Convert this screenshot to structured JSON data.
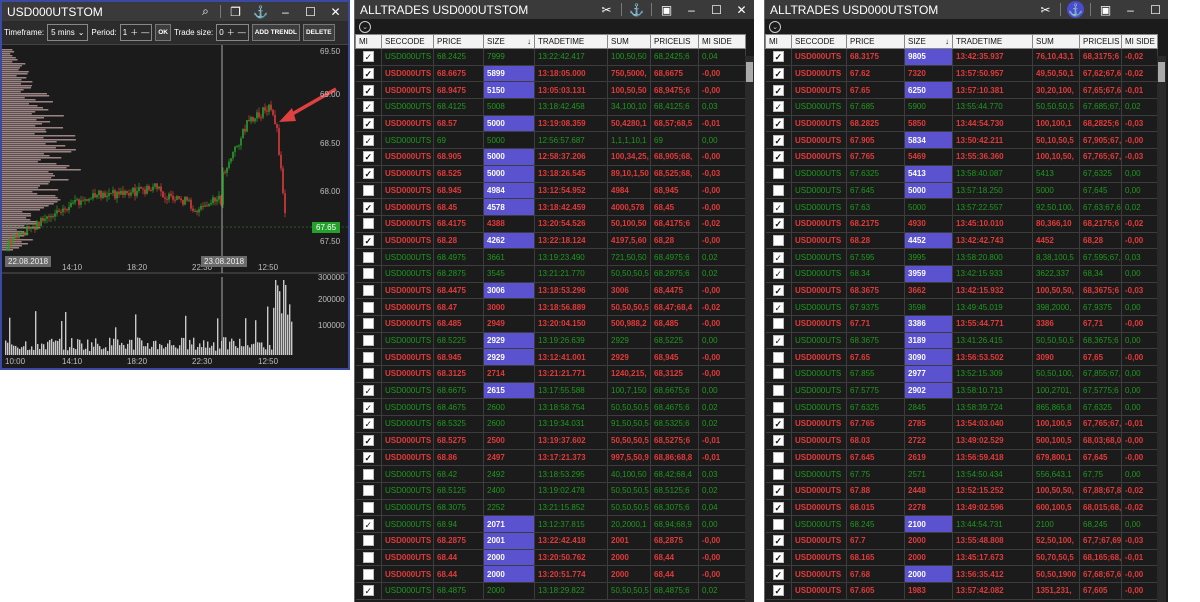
{
  "chart_window": {
    "title": "USD000UTSTOM",
    "toolbar": {
      "timeframe_label": "Timeframe:",
      "timeframe_value": "5 mins",
      "period_label": "Period:",
      "period_value": "1",
      "ok_label": "OK",
      "trade_size_label": "Trade size:",
      "trade_size_value": "0",
      "add_trendline_label": "ADD TRENDL",
      "delete_label": "DELETE"
    },
    "price_axis": [
      "69.50",
      "69.00",
      "68.50",
      "68.00",
      "67.50"
    ],
    "current_price": "67.65",
    "volume_axis": [
      "300000",
      "200000",
      "100000"
    ],
    "time_axis_top": [
      "14:10",
      "18:20",
      "22:30",
      "12:50"
    ],
    "time_axis_bottom": [
      "10:00",
      "14:10",
      "18:20",
      "22:30",
      "12:50"
    ],
    "date_tags": [
      "22.08.2018",
      "23.08.2018"
    ],
    "colors": {
      "up": "#27a127",
      "down": "#e03a3a",
      "profile": "#c8a8a8",
      "arrow": "#e04040"
    }
  },
  "trades_a": {
    "title": "ALLTRADES USD000UTSTOM",
    "columns": [
      "MI",
      "SECCODE",
      "PRICE",
      "SIZE",
      "TRADETIME",
      "SUM",
      "PRICELIS",
      "MI SIDE"
    ],
    "rows": [
      {
        "c": true,
        "s": "b",
        "sec": "USD000UTS",
        "price": "68.2425",
        "size": "7999",
        "time": "13:22:42.417",
        "sum": "100,50,50",
        "pl": "68,2425;6",
        "side": "0,04",
        "hl": false
      },
      {
        "c": true,
        "s": "s",
        "sec": "USD000UTS",
        "price": "68.6675",
        "size": "5899",
        "time": "13:18:05.000",
        "sum": "750,5000,",
        "pl": "68,6675",
        "side": "-0,00",
        "hl": true
      },
      {
        "c": true,
        "s": "s",
        "sec": "USD000UTS",
        "price": "68.9475",
        "size": "5150",
        "time": "13:05:03.131",
        "sum": "100,50,50",
        "pl": "68,9475;6",
        "side": "-0,00",
        "hl": true
      },
      {
        "c": true,
        "s": "b",
        "sec": "USD000UTS",
        "price": "68.4125",
        "size": "5008",
        "time": "13:18:42.458",
        "sum": "34,100,10",
        "pl": "68,4125;6",
        "side": "0,03",
        "hl": false
      },
      {
        "c": true,
        "s": "s",
        "sec": "USD000UTS",
        "price": "68.57",
        "size": "5000",
        "time": "13:19:08.359",
        "sum": "50,4280,1",
        "pl": "68,57;68,5",
        "side": "-0,01",
        "hl": true
      },
      {
        "c": true,
        "s": "b",
        "sec": "USD000UTS",
        "price": "69",
        "size": "5000",
        "time": "12:56:57.687",
        "sum": "1,1,1,10,1",
        "pl": "69",
        "side": "0,00",
        "hl": false
      },
      {
        "c": true,
        "s": "s",
        "sec": "USD000UTS",
        "price": "68.905",
        "size": "5000",
        "time": "12:58:37.206",
        "sum": "100,34,25,",
        "pl": "68,905;68,",
        "side": "-0,00",
        "hl": true
      },
      {
        "c": true,
        "s": "s",
        "sec": "USD000UTS",
        "price": "68.525",
        "size": "5000",
        "time": "13:18:26.545",
        "sum": "89,10,1,50",
        "pl": "68,525;68,",
        "side": "-0,03",
        "hl": true
      },
      {
        "c": false,
        "s": "s",
        "sec": "USD000UTS",
        "price": "68.945",
        "size": "4984",
        "time": "13:12:54.952",
        "sum": "4984",
        "pl": "68,945",
        "side": "-0,00",
        "hl": true
      },
      {
        "c": true,
        "s": "s",
        "sec": "USD000UTS",
        "price": "68.45",
        "size": "4578",
        "time": "13:18:42.459",
        "sum": "4000,578",
        "pl": "68,45",
        "side": "-0,00",
        "hl": true
      },
      {
        "c": false,
        "s": "s",
        "sec": "USD000UTS",
        "price": "68.4175",
        "size": "4388",
        "time": "13:20:54.526",
        "sum": "50,100,50",
        "pl": "68,4175;6",
        "side": "-0,02",
        "hl": false
      },
      {
        "c": true,
        "s": "s",
        "sec": "USD000UTS",
        "price": "68.28",
        "size": "4262",
        "time": "13:22:18.124",
        "sum": "4197,5,60",
        "pl": "68,28",
        "side": "-0,00",
        "hl": true
      },
      {
        "c": false,
        "s": "b",
        "sec": "USD000UTS",
        "price": "68.4975",
        "size": "3661",
        "time": "13:19:23.490",
        "sum": "721,50,50",
        "pl": "68,4975;6",
        "side": "0,02",
        "hl": false
      },
      {
        "c": false,
        "s": "b",
        "sec": "USD000UTS",
        "price": "68.2875",
        "size": "3545",
        "time": "13:21:21.770",
        "sum": "50,50,50,5",
        "pl": "68,2875;6",
        "side": "0,02",
        "hl": false
      },
      {
        "c": false,
        "s": "s",
        "sec": "USD000UTS",
        "price": "68.4475",
        "size": "3006",
        "time": "13:18:53.296",
        "sum": "3006",
        "pl": "68,4475",
        "side": "-0,00",
        "hl": true
      },
      {
        "c": false,
        "s": "s",
        "sec": "USD000UTS",
        "price": "68.47",
        "size": "3000",
        "time": "13:18:56.889",
        "sum": "50,50,50,5",
        "pl": "68,47;68,4",
        "side": "-0,02",
        "hl": false
      },
      {
        "c": false,
        "s": "s",
        "sec": "USD000UTS",
        "price": "68.485",
        "size": "2949",
        "time": "13:20:04.150",
        "sum": "500,988,2",
        "pl": "68,485",
        "side": "-0,00",
        "hl": false
      },
      {
        "c": false,
        "s": "b",
        "sec": "USD000UTS",
        "price": "68.5225",
        "size": "2929",
        "time": "13:19:26.639",
        "sum": "2929",
        "pl": "68,5225",
        "side": "0,00",
        "hl": true
      },
      {
        "c": false,
        "s": "s",
        "sec": "USD000UTS",
        "price": "68.945",
        "size": "2929",
        "time": "13:12:41.001",
        "sum": "2929",
        "pl": "68,945",
        "side": "-0,00",
        "hl": true
      },
      {
        "c": false,
        "s": "s",
        "sec": "USD000UTS",
        "price": "68.3125",
        "size": "2714",
        "time": "13:21:21.771",
        "sum": "1240,215,",
        "pl": "68,3125",
        "side": "-0,00",
        "hl": false
      },
      {
        "c": true,
        "s": "b",
        "sec": "USD000UTS",
        "price": "68.6675",
        "size": "2615",
        "time": "13:17:55.588",
        "sum": "100,7,150",
        "pl": "68,6675;6",
        "side": "0,00",
        "hl": true
      },
      {
        "c": true,
        "s": "b",
        "sec": "USD000UTS",
        "price": "68.4675",
        "size": "2600",
        "time": "13:18:58.754",
        "sum": "50,50,50,5",
        "pl": "68,4675;6",
        "side": "0,02",
        "hl": false
      },
      {
        "c": true,
        "s": "b",
        "sec": "USD000UTS",
        "price": "68.5325",
        "size": "2600",
        "time": "13:19:34.031",
        "sum": "91,50,50,5",
        "pl": "68,5325;6",
        "side": "0,02",
        "hl": false
      },
      {
        "c": true,
        "s": "s",
        "sec": "USD000UTS",
        "price": "68.5275",
        "size": "2500",
        "time": "13:19:37.602",
        "sum": "50,50,50,5",
        "pl": "68,5275;6",
        "side": "-0,01",
        "hl": false
      },
      {
        "c": true,
        "s": "s",
        "sec": "USD000UTS",
        "price": "68.86",
        "size": "2497",
        "time": "13:17:21.373",
        "sum": "997,5,50,9",
        "pl": "68,86;68,8",
        "side": "-0,01",
        "hl": false
      },
      {
        "c": false,
        "s": "b",
        "sec": "USD000UTS",
        "price": "68.42",
        "size": "2492",
        "time": "13:18:53.295",
        "sum": "40,100,50",
        "pl": "68,42;68,4",
        "side": "0,03",
        "hl": false
      },
      {
        "c": false,
        "s": "b",
        "sec": "USD000UTS",
        "price": "68.5125",
        "size": "2400",
        "time": "13:19:02.478",
        "sum": "50,50,50,5",
        "pl": "68,5125;6",
        "side": "0,02",
        "hl": false
      },
      {
        "c": false,
        "s": "b",
        "sec": "USD000UTS",
        "price": "68.3075",
        "size": "2252",
        "time": "13:21:15.852",
        "sum": "50,50,50,5",
        "pl": "68,3075;6",
        "side": "0,04",
        "hl": false
      },
      {
        "c": true,
        "s": "b",
        "sec": "USD000UTS",
        "price": "68.94",
        "size": "2071",
        "time": "13:12:37.815",
        "sum": "20,2000,1",
        "pl": "68,94;68,9",
        "side": "0,00",
        "hl": true
      },
      {
        "c": false,
        "s": "s",
        "sec": "USD000UTS",
        "price": "68.2875",
        "size": "2001",
        "time": "13:22:42.418",
        "sum": "2001",
        "pl": "68,2875",
        "side": "-0,00",
        "hl": true
      },
      {
        "c": false,
        "s": "s",
        "sec": "USD000UTS",
        "price": "68.44",
        "size": "2000",
        "time": "13:20:50.762",
        "sum": "2000",
        "pl": "68,44",
        "side": "-0,00",
        "hl": true
      },
      {
        "c": false,
        "s": "s",
        "sec": "USD000UTS",
        "price": "68.44",
        "size": "2000",
        "time": "13:20:51.774",
        "sum": "2000",
        "pl": "68,44",
        "side": "-0,00",
        "hl": true
      },
      {
        "c": true,
        "s": "b",
        "sec": "USD000UTS",
        "price": "68.4875",
        "size": "2000",
        "time": "13:18:29.822",
        "sum": "50,50,50,5",
        "pl": "68,4875;6",
        "side": "0,02",
        "hl": false
      }
    ]
  },
  "trades_b": {
    "title": "ALLTRADES USD000UTSTOM",
    "columns": [
      "MI",
      "SECCODE",
      "PRICE",
      "SIZE",
      "TRADETIME",
      "SUM",
      "PRICELIS",
      "MI SIDE"
    ],
    "rows": [
      {
        "c": true,
        "s": "s",
        "sec": "USD000UTS",
        "price": "68.3175",
        "size": "9805",
        "time": "13:42:35.937",
        "sum": "76,10,43,1",
        "pl": "68,3175;6",
        "side": "-0,02",
        "hl": true
      },
      {
        "c": true,
        "s": "s",
        "sec": "USD000UTS",
        "price": "67.62",
        "size": "7320",
        "time": "13:57:50.957",
        "sum": "49,50,50,1",
        "pl": "67,62;67,6",
        "side": "-0,02",
        "hl": false
      },
      {
        "c": true,
        "s": "s",
        "sec": "USD000UTS",
        "price": "67.65",
        "size": "6250",
        "time": "13:57:10.381",
        "sum": "30,20,100,",
        "pl": "67,65;67,6",
        "side": "-0,01",
        "hl": true
      },
      {
        "c": true,
        "s": "b",
        "sec": "USD000UTS",
        "price": "67.685",
        "size": "5900",
        "time": "13:55:44.770",
        "sum": "50,50,50,5",
        "pl": "67,685;67,",
        "side": "0,02",
        "hl": false
      },
      {
        "c": true,
        "s": "s",
        "sec": "USD000UTS",
        "price": "68.2825",
        "size": "5850",
        "time": "13:44:54.730",
        "sum": "100,100,1",
        "pl": "68,2825;6",
        "side": "-0,03",
        "hl": false
      },
      {
        "c": true,
        "s": "s",
        "sec": "USD000UTS",
        "price": "67.905",
        "size": "5834",
        "time": "13:50:42.211",
        "sum": "50,10,50,5",
        "pl": "67,905;67,",
        "side": "-0,00",
        "hl": true
      },
      {
        "c": true,
        "s": "s",
        "sec": "USD000UTS",
        "price": "67.765",
        "size": "5469",
        "time": "13:55:36.360",
        "sum": "100,10,50,",
        "pl": "67,765;67,",
        "side": "-0,03",
        "hl": false
      },
      {
        "c": false,
        "s": "b",
        "sec": "USD000UTS",
        "price": "67.6325",
        "size": "5413",
        "time": "13:58:40.087",
        "sum": "5413",
        "pl": "67,6325",
        "side": "0,00",
        "hl": true
      },
      {
        "c": false,
        "s": "b",
        "sec": "USD000UTS",
        "price": "67.645",
        "size": "5000",
        "time": "13:57:18.250",
        "sum": "5000",
        "pl": "67,645",
        "side": "0,00",
        "hl": true
      },
      {
        "c": true,
        "s": "b",
        "sec": "USD000UTS",
        "price": "67.63",
        "size": "5000",
        "time": "13:57:22.557",
        "sum": "92,50,100,",
        "pl": "67,63;67,6",
        "side": "0,02",
        "hl": false
      },
      {
        "c": true,
        "s": "s",
        "sec": "USD000UTS",
        "price": "68.2175",
        "size": "4930",
        "time": "13:45:10.010",
        "sum": "80,366,10",
        "pl": "68,2175;6",
        "side": "-0,02",
        "hl": false
      },
      {
        "c": false,
        "s": "s",
        "sec": "USD000UTS",
        "price": "68.28",
        "size": "4452",
        "time": "13:42:42.743",
        "sum": "4452",
        "pl": "68,28",
        "side": "-0,00",
        "hl": true
      },
      {
        "c": true,
        "s": "b",
        "sec": "USD000UTS",
        "price": "67.595",
        "size": "3995",
        "time": "13:58:20.800",
        "sum": "8,38,100,5",
        "pl": "67,595;67,",
        "side": "0,03",
        "hl": false
      },
      {
        "c": true,
        "s": "b",
        "sec": "USD000UTS",
        "price": "68.34",
        "size": "3959",
        "time": "13:42:15.933",
        "sum": "3622,337",
        "pl": "68,34",
        "side": "0,00",
        "hl": true
      },
      {
        "c": true,
        "s": "s",
        "sec": "USD000UTS",
        "price": "68.3675",
        "size": "3662",
        "time": "13:42:15.932",
        "sum": "100,50,50,",
        "pl": "68,3675;6",
        "side": "-0,03",
        "hl": false
      },
      {
        "c": true,
        "s": "b",
        "sec": "USD000UTS",
        "price": "67.9375",
        "size": "3598",
        "time": "13:49:45.019",
        "sum": "398,2000,",
        "pl": "67,9375",
        "side": "0,00",
        "hl": false
      },
      {
        "c": false,
        "s": "s",
        "sec": "USD000UTS",
        "price": "67.71",
        "size": "3386",
        "time": "13:55:44.771",
        "sum": "3386",
        "pl": "67,71",
        "side": "-0,00",
        "hl": true
      },
      {
        "c": true,
        "s": "b",
        "sec": "USD000UTS",
        "price": "68.3675",
        "size": "3189",
        "time": "13:41:26.415",
        "sum": "50,50,50,5",
        "pl": "68,3675;6",
        "side": "0,00",
        "hl": true
      },
      {
        "c": false,
        "s": "s",
        "sec": "USD000UTS",
        "price": "67.65",
        "size": "3090",
        "time": "13:56:53.502",
        "sum": "3090",
        "pl": "67,65",
        "side": "-0,00",
        "hl": true
      },
      {
        "c": false,
        "s": "b",
        "sec": "USD000UTS",
        "price": "67.855",
        "size": "2977",
        "time": "13:52:15.309",
        "sum": "50,50,100,",
        "pl": "67,855;67,",
        "side": "0,00",
        "hl": true
      },
      {
        "c": false,
        "s": "b",
        "sec": "USD000UTS",
        "price": "67.5775",
        "size": "2902",
        "time": "13:58:10.713",
        "sum": "100,2701,",
        "pl": "67,5775;6",
        "side": "0,00",
        "hl": true
      },
      {
        "c": false,
        "s": "b",
        "sec": "USD000UTS",
        "price": "67.6325",
        "size": "2845",
        "time": "13:58:39.724",
        "sum": "865,865,8",
        "pl": "67,6325",
        "side": "0,00",
        "hl": false
      },
      {
        "c": true,
        "s": "s",
        "sec": "USD000UTS",
        "price": "67.765",
        "size": "2785",
        "time": "13:54:03.040",
        "sum": "100,100,5",
        "pl": "67,765;67,",
        "side": "-0,01",
        "hl": false
      },
      {
        "c": true,
        "s": "s",
        "sec": "USD000UTS",
        "price": "68.03",
        "size": "2722",
        "time": "13:49:02.529",
        "sum": "500,100,5",
        "pl": "68,03;68,0",
        "side": "-0,00",
        "hl": false
      },
      {
        "c": false,
        "s": "s",
        "sec": "USD000UTS",
        "price": "67.645",
        "size": "2619",
        "time": "13:56:59.418",
        "sum": "679,800,1",
        "pl": "67,645",
        "side": "-0,00",
        "hl": false
      },
      {
        "c": false,
        "s": "b",
        "sec": "USD000UTS",
        "price": "67.75",
        "size": "2571",
        "time": "13:54:50.434",
        "sum": "556,643,1",
        "pl": "67,75",
        "side": "0,00",
        "hl": false
      },
      {
        "c": true,
        "s": "s",
        "sec": "USD000UTS",
        "price": "67.88",
        "size": "2448",
        "time": "13:52:15.252",
        "sum": "100,50,50,",
        "pl": "67,88;67,8",
        "side": "-0,02",
        "hl": false
      },
      {
        "c": true,
        "s": "s",
        "sec": "USD000UTS",
        "price": "68.015",
        "size": "2278",
        "time": "13:49:02.596",
        "sum": "600,100,5",
        "pl": "68,015;68,",
        "side": "-0,02",
        "hl": false
      },
      {
        "c": false,
        "s": "b",
        "sec": "USD000UTS",
        "price": "68.245",
        "size": "2100",
        "time": "13:44:54.731",
        "sum": "2100",
        "pl": "68,245",
        "side": "0,00",
        "hl": true
      },
      {
        "c": true,
        "s": "s",
        "sec": "USD000UTS",
        "price": "67.7",
        "size": "2000",
        "time": "13:55:48.808",
        "sum": "52,50,100,",
        "pl": "67,7;67,69",
        "side": "-0,03",
        "hl": false
      },
      {
        "c": true,
        "s": "s",
        "sec": "USD000UTS",
        "price": "68.165",
        "size": "2000",
        "time": "13:45:17.673",
        "sum": "50,70,50,5",
        "pl": "68,165;68,",
        "side": "-0,01",
        "hl": false
      },
      {
        "c": true,
        "s": "s",
        "sec": "USD000UTS",
        "price": "67.68",
        "size": "2000",
        "time": "13:56:35.412",
        "sum": "50,50,1900",
        "pl": "67,68;67,6",
        "side": "-0,00",
        "hl": true
      },
      {
        "c": true,
        "s": "s",
        "sec": "USD000UTS",
        "price": "67.605",
        "size": "1983",
        "time": "13:57:42.082",
        "sum": "1351,231,",
        "pl": "67,605",
        "side": "-0,00",
        "hl": false
      }
    ]
  }
}
